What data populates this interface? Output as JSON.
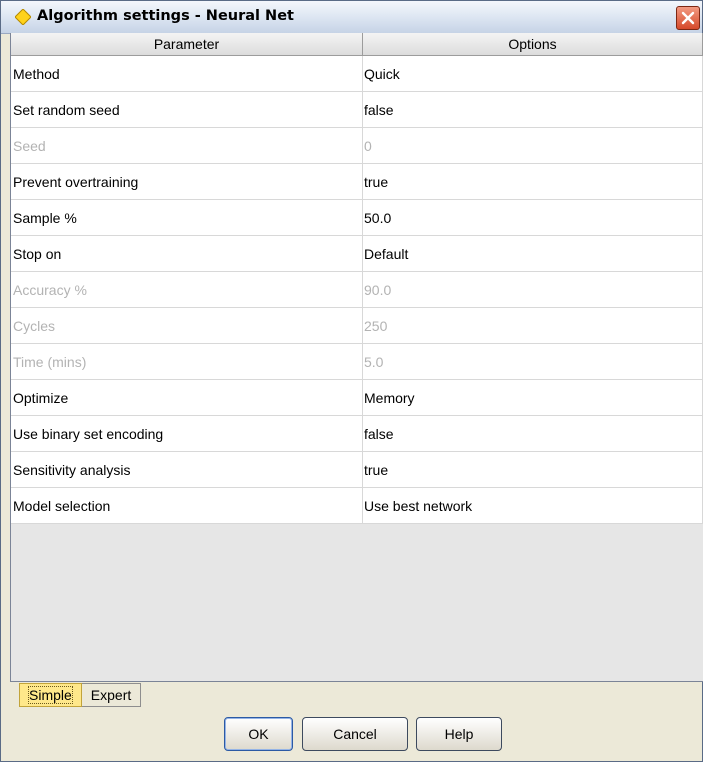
{
  "window": {
    "title": "Algorithm settings - Neural Net"
  },
  "table": {
    "columns": [
      "Parameter",
      "Options"
    ],
    "rows": [
      {
        "parameter": "Method",
        "option": "Quick",
        "enabled": true
      },
      {
        "parameter": "Set random seed",
        "option": "false",
        "enabled": true
      },
      {
        "parameter": "Seed",
        "option": "0",
        "enabled": false
      },
      {
        "parameter": "Prevent overtraining",
        "option": "true",
        "enabled": true
      },
      {
        "parameter": "Sample %",
        "option": "50.0",
        "enabled": true
      },
      {
        "parameter": "Stop on",
        "option": "Default",
        "enabled": true
      },
      {
        "parameter": "Accuracy %",
        "option": "90.0",
        "enabled": false
      },
      {
        "parameter": "Cycles",
        "option": "250",
        "enabled": false
      },
      {
        "parameter": "Time (mins)",
        "option": "5.0",
        "enabled": false
      },
      {
        "parameter": "Optimize",
        "option": "Memory",
        "enabled": true
      },
      {
        "parameter": "Use binary set encoding",
        "option": "false",
        "enabled": true
      },
      {
        "parameter": "Sensitivity analysis",
        "option": "true",
        "enabled": true
      },
      {
        "parameter": "Model selection",
        "option": "Use best network",
        "enabled": true
      }
    ]
  },
  "tabs": [
    "Simple",
    "Expert"
  ],
  "buttons": {
    "ok": "OK",
    "cancel": "Cancel",
    "help": "Help"
  },
  "colors": {
    "title_icon": "#ffd21a",
    "close": "#d6492a",
    "active_tab": "#ffe88a",
    "disabled_text": "#b3b3b3"
  },
  "icons": {
    "title": "diamond-icon",
    "close": "close-icon"
  }
}
